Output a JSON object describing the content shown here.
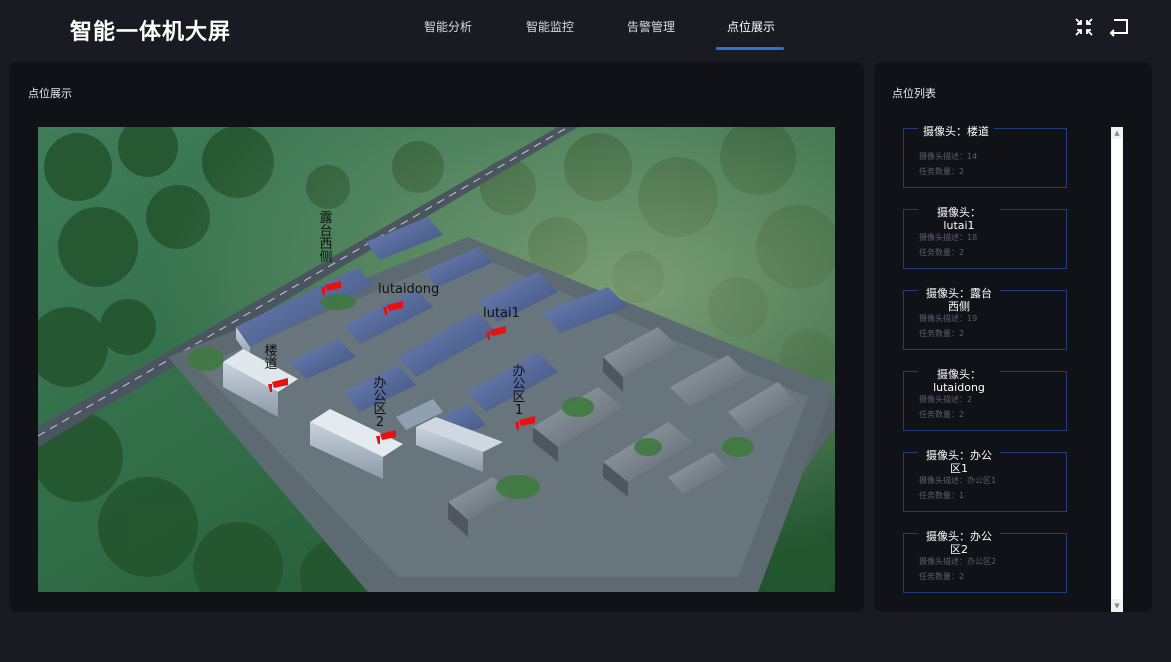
{
  "app": {
    "title": "智能一体机大屏"
  },
  "nav": {
    "tabs": [
      {
        "label": "智能分析"
      },
      {
        "label": "智能监控"
      },
      {
        "label": "告警管理"
      },
      {
        "label": "点位展示",
        "active": true
      }
    ],
    "active_color": "#2f6fd6"
  },
  "header_actions": {
    "collapse_icon": "collapse-arrows-icon",
    "back_icon": "return-icon"
  },
  "map_panel": {
    "title": "点位展示",
    "markers": [
      {
        "label": "露台西侧",
        "icon": "camera-icon"
      },
      {
        "label": "lutaidong",
        "icon": "camera-icon"
      },
      {
        "label": "lutai1",
        "icon": "camera-icon"
      },
      {
        "label": "楼道",
        "icon": "camera-icon"
      },
      {
        "label": "办公区2",
        "icon": "camera-icon"
      },
      {
        "label": "办公区1",
        "icon": "camera-icon"
      }
    ],
    "marker_color": "#e81010"
  },
  "list_panel": {
    "title": "点位列表",
    "cameras": [
      {
        "name": "摄像头：楼道",
        "desc": "摄像头描述：14",
        "tasks": "任务数量：2"
      },
      {
        "name": "摄像头：lutai1",
        "desc": "摄像头描述：18",
        "tasks": "任务数量：2"
      },
      {
        "name": "摄像头：露台西侧",
        "desc": "摄像头描述：19",
        "tasks": "任务数量：2"
      },
      {
        "name": "摄像头：lutaidong",
        "desc": "摄像头描述：2",
        "tasks": "任务数量：2"
      },
      {
        "name": "摄像头：办公区1",
        "desc": "摄像头描述：办公区1",
        "tasks": "任务数量：1"
      },
      {
        "name": "摄像头：办公区2",
        "desc": "摄像头描述：办公区2",
        "tasks": "任务数量：2"
      }
    ],
    "card_border_color": "#1e3f7a"
  },
  "scrollbar": {
    "up": "▲",
    "down": "▼"
  }
}
